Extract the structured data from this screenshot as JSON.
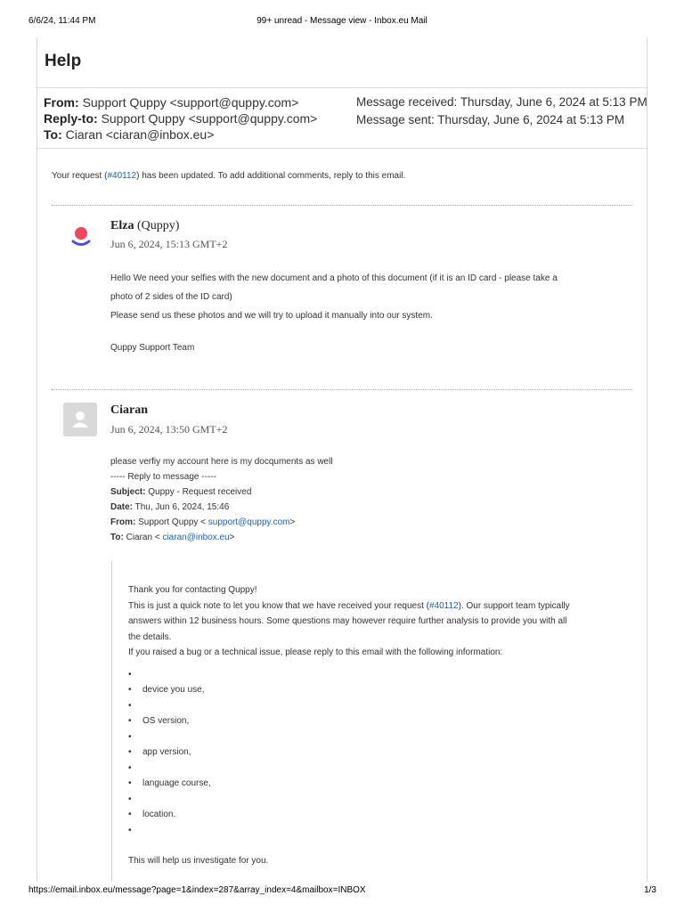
{
  "print": {
    "date": "6/6/24, 11:44 PM",
    "title": "99+ unread - Message view - Inbox.eu Mail",
    "url": "https://email.inbox.eu/message?page=1&index=287&array_index=4&mailbox=INBOX",
    "page": "1/3"
  },
  "message": {
    "subject": "Help",
    "from_label": "From:",
    "from_value": "Support Quppy <support@quppy.com>",
    "replyto_label": "Reply-to:",
    "replyto_value": "Support Quppy <support@quppy.com>",
    "to_label": "To:",
    "to_value": "Ciaran <ciaran@inbox.eu>",
    "received": "Message received: Thursday, June 6, 2024 at 5:13 PM",
    "sent": "Message sent: Thursday, June 6, 2024 at 5:13 PM"
  },
  "intro": {
    "pre": "Your request (",
    "link": "#40112",
    "post": ") has been updated. To add additional comments, reply to this email."
  },
  "comment1": {
    "author": "Elza",
    "author_suffix": "(Quppy)",
    "timestamp": "Jun 6, 2024, 15:13 GMT+2",
    "line1": "Hello  We need your selfies with the new document and a photo of this document (if it is an ID card - please take a",
    "line2": "photo of 2 sides of the ID card)",
    "line3": "Please send us these photos and we will try to upload it manually into our system.",
    "signature": "Quppy Support Team"
  },
  "comment2": {
    "author": "Ciaran",
    "timestamp": "Jun 6, 2024, 13:50 GMT+2",
    "line1": "please verfiy my account here is my docquments as well",
    "reply_marker": "----- Reply to message -----",
    "subject_label": "Subject:",
    "subject_value": "Quppy - Request received",
    "date_label": "Date:",
    "date_value": "Thu, Jun 6, 2024, 15:46",
    "from_label": "From:",
    "from_pre": "Support Quppy < ",
    "from_link": "support@quppy.com",
    "from_post": ">",
    "to_label": "To:",
    "to_pre": "Ciaran < ",
    "to_link": "ciaran@inbox.eu",
    "to_post": ">"
  },
  "quoted": {
    "thanks": "Thank you for contacting Quppy!",
    "line1_pre": "This is just a quick note to let you know that we have received your request (",
    "line1_link": "#40112",
    "line1_post": "). Our support team typically",
    "line2": "answers within 12 business hours. Some questions may however require further analysis to provide you with all",
    "line3": "the details.",
    "line4": "If you raised a bug or a technical issue, please reply to this email with the following information:",
    "bullets": [
      "",
      "device you use,",
      "",
      "OS version,",
      "",
      "app version,",
      "",
      "language course,",
      "",
      "location.",
      ""
    ],
    "closing": "This will help us investigate for you."
  },
  "colors": {
    "link": "#1f62a8",
    "quppy_red": "#ef4760",
    "quppy_blue": "#4a4fe0"
  }
}
